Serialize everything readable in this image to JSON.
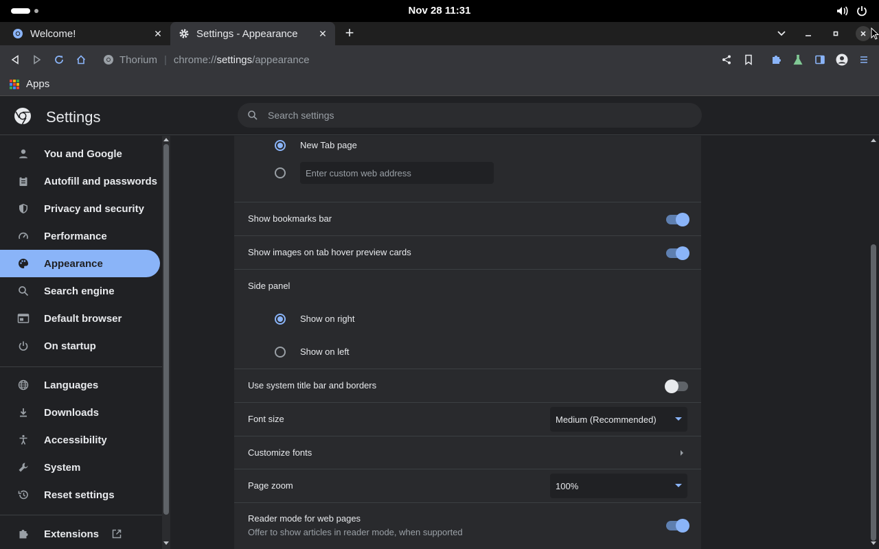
{
  "system": {
    "datetime": "Nov 28  11:31"
  },
  "tabs": [
    {
      "title": "Welcome!",
      "active": false
    },
    {
      "title": "Settings - Appearance",
      "active": true
    }
  ],
  "omnibox": {
    "site": "Thorium",
    "url_prefix": "chrome://",
    "url_host": "settings",
    "url_path": "/appearance"
  },
  "bookmarks": {
    "apps_label": "Apps"
  },
  "settings": {
    "title": "Settings",
    "search_placeholder": "Search settings"
  },
  "sidebar": {
    "items": [
      {
        "label": "You and Google",
        "icon": "person-icon"
      },
      {
        "label": "Autofill and passwords",
        "icon": "clipboard-icon"
      },
      {
        "label": "Privacy and security",
        "icon": "shield-icon"
      },
      {
        "label": "Performance",
        "icon": "speedometer-icon"
      },
      {
        "label": "Appearance",
        "icon": "palette-icon",
        "selected": true
      },
      {
        "label": "Search engine",
        "icon": "search-icon"
      },
      {
        "label": "Default browser",
        "icon": "browser-icon"
      },
      {
        "label": "On startup",
        "icon": "power-icon"
      },
      {
        "label": "Languages",
        "icon": "globe-icon"
      },
      {
        "label": "Downloads",
        "icon": "download-icon"
      },
      {
        "label": "Accessibility",
        "icon": "accessibility-icon"
      },
      {
        "label": "System",
        "icon": "wrench-icon"
      },
      {
        "label": "Reset settings",
        "icon": "history-icon"
      }
    ],
    "extensions_label": "Extensions"
  },
  "content": {
    "home_new_tab": "New Tab page",
    "home_custom_placeholder": "Enter custom web address",
    "show_bookmarks_bar": "Show bookmarks bar",
    "show_images_hover": "Show images on tab hover preview cards",
    "side_panel": "Side panel",
    "side_panel_right": "Show on right",
    "side_panel_left": "Show on left",
    "system_title_bar": "Use system title bar and borders",
    "font_size": "Font size",
    "font_size_value": "Medium (Recommended)",
    "customize_fonts": "Customize fonts",
    "page_zoom": "Page zoom",
    "page_zoom_value": "100%",
    "reader_mode": "Reader mode for web pages",
    "reader_mode_sub": "Offer to show articles in reader mode, when supported"
  },
  "colors": {
    "accent": "#8ab4f8",
    "background": "#202124",
    "card": "#292a2d"
  }
}
